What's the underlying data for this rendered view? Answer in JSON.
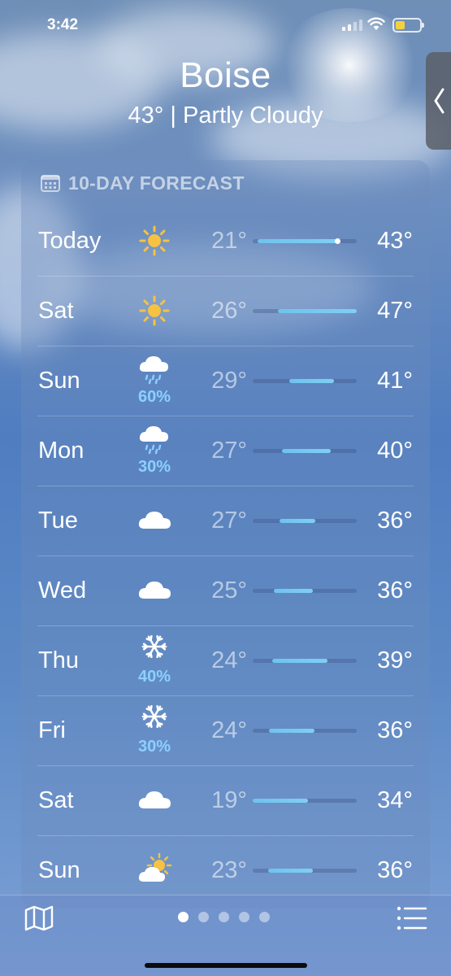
{
  "status_bar": {
    "time": "3:42"
  },
  "header": {
    "city": "Boise",
    "summary": "43° | Partly Cloudy"
  },
  "forecast": {
    "title": "10-DAY FORECAST",
    "rows": [
      {
        "day": "Today",
        "icon": "sun-icon",
        "precip": "",
        "low": "21°",
        "high": "43°",
        "range": [
          0.05,
          0.81
        ],
        "current": 0.81
      },
      {
        "day": "Sat",
        "icon": "sun-icon",
        "precip": "",
        "low": "26°",
        "high": "47°",
        "range": [
          0.24,
          1.0
        ]
      },
      {
        "day": "Sun",
        "icon": "rain-cloud-icon",
        "precip": "60%",
        "low": "29°",
        "high": "41°",
        "range": [
          0.35,
          0.78
        ]
      },
      {
        "day": "Mon",
        "icon": "rain-cloud-icon",
        "precip": "30%",
        "low": "27°",
        "high": "40°",
        "range": [
          0.28,
          0.75
        ]
      },
      {
        "day": "Tue",
        "icon": "cloud-icon",
        "precip": "",
        "low": "27°",
        "high": "36°",
        "range": [
          0.26,
          0.6
        ]
      },
      {
        "day": "Wed",
        "icon": "cloud-icon",
        "precip": "",
        "low": "25°",
        "high": "36°",
        "range": [
          0.2,
          0.58
        ]
      },
      {
        "day": "Thu",
        "icon": "snowflake-icon",
        "precip": "40%",
        "low": "24°",
        "high": "39°",
        "range": [
          0.19,
          0.72
        ]
      },
      {
        "day": "Fri",
        "icon": "snowflake-icon",
        "precip": "30%",
        "low": "24°",
        "high": "36°",
        "range": [
          0.16,
          0.59
        ]
      },
      {
        "day": "Sat",
        "icon": "cloud-icon",
        "precip": "",
        "low": "19°",
        "high": "34°",
        "range": [
          0.0,
          0.53
        ]
      },
      {
        "day": "Sun",
        "icon": "partly-cloudy-icon",
        "precip": "",
        "low": "23°",
        "high": "36°",
        "range": [
          0.15,
          0.58
        ]
      }
    ]
  },
  "pager": {
    "count": 5,
    "active": 0
  },
  "colors": {
    "precip": "#8cd0ff",
    "sun": "#f5c242",
    "bar": "#6ec3ee"
  }
}
